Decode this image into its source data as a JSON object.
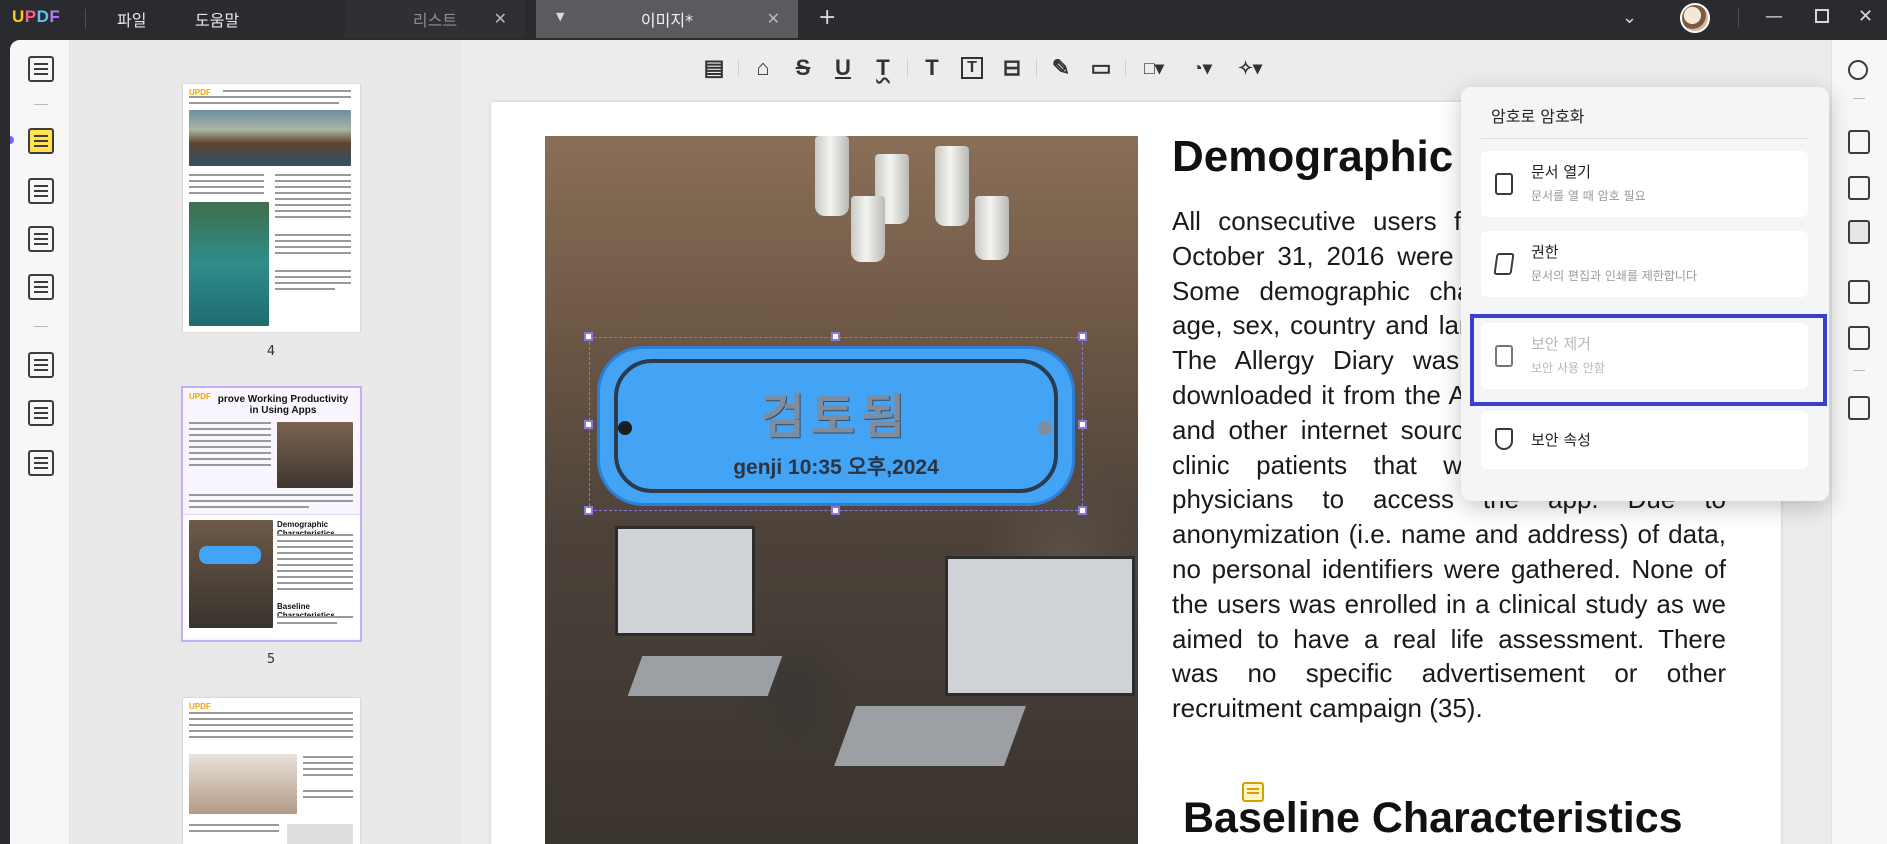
{
  "app": {
    "logo": [
      "U",
      "P",
      "D",
      "F"
    ],
    "menu": {
      "file": "파일",
      "help": "도움말"
    }
  },
  "tabs": [
    {
      "label": "리스트",
      "active": false
    },
    {
      "label": "이미지*",
      "active": true
    }
  ],
  "thumbnails": {
    "page4_label": "4",
    "page5_label": "5",
    "page5_heading": "prove Working Productivity in Using Apps",
    "page5_sub_heading": "Demographic Characteristics",
    "page5_sub_heading2": "Baseline Characteristics"
  },
  "stamp": {
    "title": "검토됨",
    "subtitle": "genji 10:35 오후,2024",
    "color": "#43a3f5"
  },
  "document": {
    "heading": "Demographic Characteristics",
    "paragraph": "All consecutive users from May 1, 2016 to October 31, 2016 were included in the study. Some demographic characteristics (such as age, sex, country and language) were entered. The Allergy Diary was freely available and downloaded it from the App Store, Google Play and other internet sources. A few users were clinic patients that were asked by their physicians to access the app. Due to anonymization (i.e. name and address) of data, no personal identifiers were gathered. None of the users was enrolled in a clinical study as we aimed to have a real life assessment. There was no specific advertisement or other recruitment campaign (35).",
    "heading2": "Baseline Characteristics"
  },
  "security_popover": {
    "title": "암호로 암호화",
    "options": [
      {
        "title": "문서 열기",
        "subtitle": "문서를 열 때 암호 필요",
        "icon": "lock-doc-icon",
        "enabled": true
      },
      {
        "title": "권한",
        "subtitle": "문서의 편집과 인쇄를 제한합니다",
        "icon": "edit-doc-icon",
        "enabled": true
      },
      {
        "title": "보안 제거",
        "subtitle": "보안 사용 안함",
        "icon": "unlock-icon",
        "enabled": false
      },
      {
        "title": "보안 속성",
        "subtitle": "",
        "icon": "shield-icon",
        "enabled": true
      }
    ]
  },
  "colors": {
    "highlight": "#3b3fcf",
    "selection": "#8a78d8",
    "accent": "#7b61ff"
  }
}
